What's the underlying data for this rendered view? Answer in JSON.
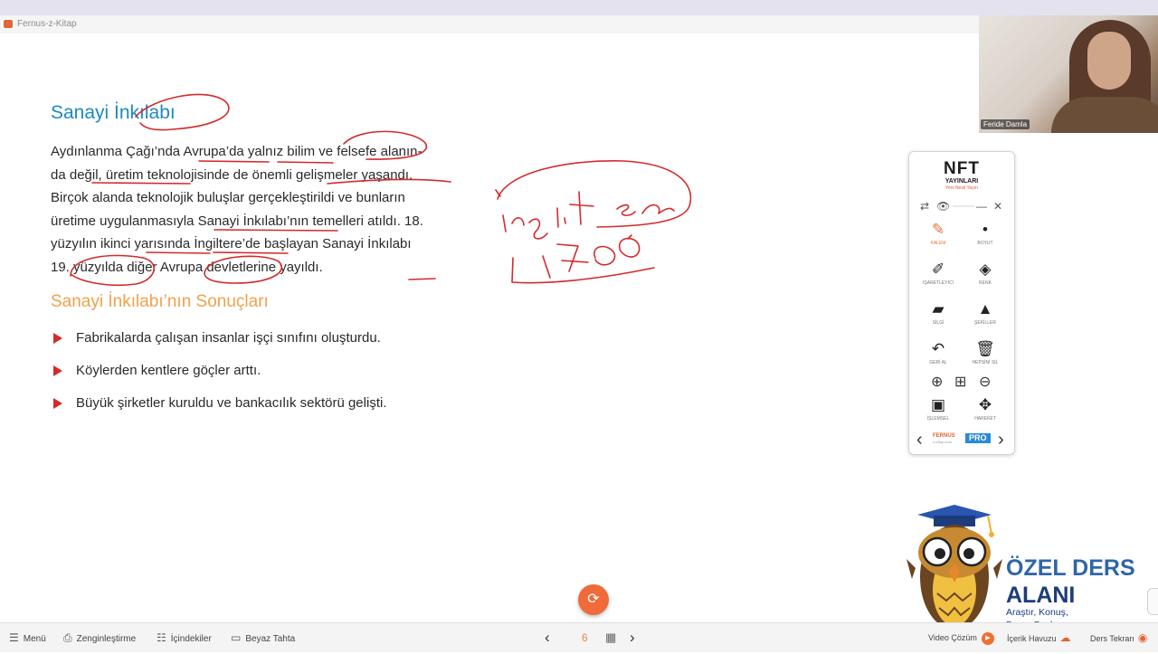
{
  "app": {
    "title": "Fernus-z-Kitap"
  },
  "content": {
    "heading": "Sanayi İnkılabı",
    "paragraph_lines": [
      "Aydınlanma Çağı’nda Avrupa’da yalnız bilim ve felsefe alanın-",
      "da değil, üretim teknolojisinde de önemli gelişmeler yaşandı.",
      "Birçok alanda teknolojik buluşlar gerçekleştirildi ve bunların",
      "üretime uygulanmasıyla Sanayi İnkılabı’nın temelleri atıldı. 18.",
      "yüzyılın ikinci yarısında İngiltere’de başlayan Sanayi İnkılabı",
      "19. yüzyılda diğer Avrupa devletlerine yayıldı."
    ],
    "subheading": "Sanayi İnkılabı’nın Sonuçları",
    "bullets": [
      "Fabrikalarda çalışan insanlar işçi sınıfını oluşturdu.",
      "Köylerden kentlere göçler arttı.",
      "Büyük şirketler kuruldu ve bankacılık sektörü gelişti."
    ]
  },
  "annotation_color": "#d42a2a",
  "handwriting": {
    "word": "ingiltere",
    "year": "1700"
  },
  "webcam": {
    "name_label": "Feride Damla"
  },
  "tool_panel": {
    "logo_big": "NFT",
    "logo_small": "YAYINLARI",
    "logo_tag": "Yeni Nesil Yayın",
    "tools": [
      {
        "label": "KALEM",
        "icon": "pencil"
      },
      {
        "label": "BOYUT",
        "icon": "dot"
      },
      {
        "label": "İŞARETLEYİCİ",
        "icon": "marker"
      },
      {
        "label": "RENK",
        "icon": "paint-bucket"
      },
      {
        "label": "SİLGİ",
        "icon": "eraser"
      },
      {
        "label": "ŞEKİLLER",
        "icon": "shapes"
      },
      {
        "label": "GERİ AL",
        "icon": "undo"
      },
      {
        "label": "HEPSİNİ SİL",
        "icon": "trash"
      },
      {
        "label": "İŞLEMSEL",
        "icon": "screen"
      },
      {
        "label": "HAREKET",
        "icon": "move"
      }
    ],
    "footer_brand": "FERNUS",
    "footer_sub": "z-Kitap.com",
    "footer_pro": "PRO"
  },
  "brand": {
    "title_line1": "ÖZEL DERS",
    "title_line2": "ALANI",
    "subtitle_line1": "Araştır, Konuş,",
    "subtitle_line2": "Derse Başla"
  },
  "bottom_bar": {
    "menu": "Menü",
    "zenginlestirme": "Zenginleştirme",
    "icindekiler": "İçindekiler",
    "beyaz_tahta": "Beyaz Tahta",
    "page_number": "6",
    "video_cozum": "Video Çözüm",
    "icerik_havuzu": "İçerik Havuzu",
    "ders_tekrari": "Ders Tekrarı"
  }
}
